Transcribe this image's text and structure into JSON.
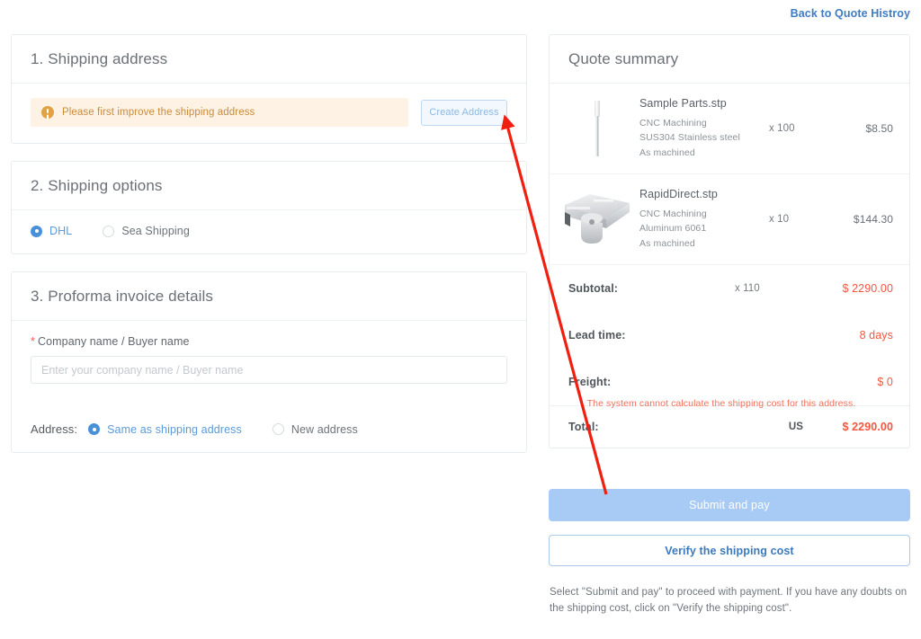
{
  "header": {
    "back_link": "Back to Quote Histroy"
  },
  "left": {
    "shipping_address": {
      "title": "1. Shipping address",
      "warning_text": "Please first improve the shipping address",
      "warning_icon": "exclamation-circle-icon",
      "create_address_button": "Create Address"
    },
    "shipping_options": {
      "title": "2. Shipping options",
      "options": [
        {
          "label": "DHL",
          "selected": true
        },
        {
          "label": "Sea Shipping",
          "selected": false
        }
      ]
    },
    "proforma": {
      "title": "3. Proforma invoice details",
      "company_label": "Company name / Buyer name",
      "company_required_mark": "*",
      "company_value": "",
      "company_placeholder": "Enter your company name / Buyer name",
      "address_caption": "Address:",
      "address_options": [
        {
          "label": "Same as shipping address",
          "selected": true
        },
        {
          "label": "New address",
          "selected": false
        }
      ]
    }
  },
  "right": {
    "title": "Quote summary",
    "items": [
      {
        "name": "Sample Parts.stp",
        "process": "CNC Machining",
        "material": "SUS304 Stainless steel",
        "finish": "As machined",
        "qty": "x 100",
        "price": "$8.50",
        "thumb": "thin-rod-part-image"
      },
      {
        "name": "RapidDirect.stp",
        "process": "CNC Machining",
        "material": "Aluminum 6061",
        "finish": "As machined",
        "qty": "x 10",
        "price": "$144.30",
        "thumb": "machined-housing-part-image"
      }
    ],
    "subtotal": {
      "label": "Subtotal:",
      "qty": "x 110",
      "value": "$ 2290.00"
    },
    "lead_time": {
      "label": "Lead time:",
      "value": "8 days"
    },
    "freight": {
      "label": "Freight:",
      "value": "$ 0",
      "note": "The system cannot calculate the shipping cost for this address."
    },
    "total": {
      "label": "Total:",
      "currency": "US",
      "value": "$ 2290.00"
    },
    "submit_button": "Submit and pay",
    "verify_button": "Verify the shipping cost",
    "help_text": "Select \"Submit and pay\" to proceed with payment. If you have any doubts on the shipping cost, click on \"Verify the shipping cost\"."
  },
  "annotation": {
    "arrow_color": "#f01f0f",
    "arrow_from": "672,548",
    "arrow_to": "561,133"
  },
  "colors": {
    "accent_blue": "#4a90d9",
    "price_red": "#f4573f",
    "warning_amber": "#c98c3c",
    "warning_bg": "#fdf2e4",
    "primary_button": "#a8cbf5"
  }
}
